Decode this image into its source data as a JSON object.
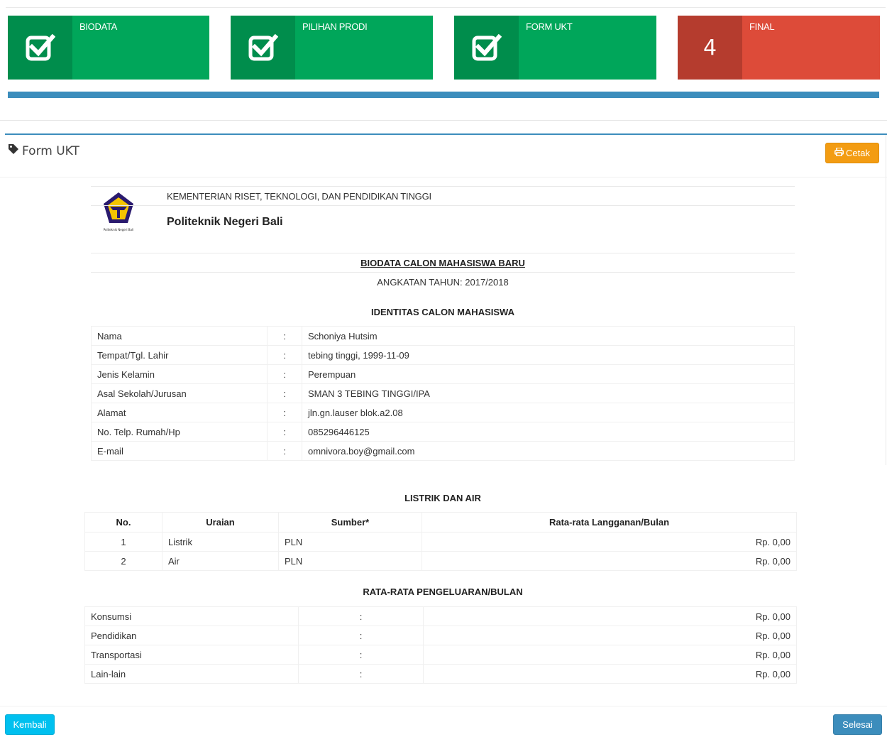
{
  "steps": [
    {
      "label": "BIODATA",
      "state": "done",
      "icon": "check-square-icon"
    },
    {
      "label": "PILIHAN PRODI",
      "state": "done",
      "icon": "check-square-icon"
    },
    {
      "label": "FORM UKT",
      "state": "done",
      "icon": "check-square-icon"
    },
    {
      "label": "FINAL",
      "state": "current",
      "number": "4"
    }
  ],
  "progress": {
    "percent": 100,
    "color": "#3c8dbc"
  },
  "colors": {
    "done_dark": "#008d4c",
    "done": "#00a65a",
    "current_dark": "#b53c2e",
    "current": "#dd4b39",
    "primary": "#3c8dbc",
    "warning": "#f39c12",
    "info": "#00c0ef"
  },
  "box": {
    "title": "Form UKT",
    "title_icon": "tag-icon",
    "print_label": "Cetak",
    "print_icon": "print-icon"
  },
  "header": {
    "ministry": "KEMENTERIAN RISET, TEKNOLOGI, DAN PENDIDIKAN TINGGI",
    "institution": "Politeknik Negeri Bali",
    "logo_caption": "Politeknik Negeri Bali"
  },
  "document": {
    "title": "BIODATA CALON MAHASISWA BARU",
    "subtitle": "ANGKATAN TAHUN: 2017/2018",
    "identity_heading": "IDENTITAS CALON MAHASISWA",
    "identity": [
      {
        "label": "Nama",
        "sep": ":",
        "value": "Schoniya Hutsim"
      },
      {
        "label": "Tempat/Tgl. Lahir",
        "sep": ":",
        "value": "tebing tinggi, 1999-11-09"
      },
      {
        "label": "Jenis Kelamin",
        "sep": ":",
        "value": "Perempuan"
      },
      {
        "label": "Asal Sekolah/Jurusan",
        "sep": ":",
        "value": "SMAN 3 TEBING TINGGI/IPA"
      },
      {
        "label": "Alamat",
        "sep": ":",
        "value": "jln.gn.lauser blok.a2.08"
      },
      {
        "label": "No. Telp. Rumah/Hp",
        "sep": ":",
        "value": "085296446125"
      },
      {
        "label": "E-mail",
        "sep": ":",
        "value": "omnivora.boy@gmail.com"
      }
    ],
    "utility_heading": "LISTRIK DAN AIR",
    "utility_columns": [
      "No.",
      "Uraian",
      "Sumber*",
      "Rata-rata Langganan/Bulan"
    ],
    "utility_rows": [
      {
        "no": "1",
        "uraian": "Listrik",
        "sumber": "PLN",
        "rata": "Rp. 0,00"
      },
      {
        "no": "2",
        "uraian": "Air",
        "sumber": "PLN",
        "rata": "Rp. 0,00"
      }
    ],
    "expense_heading": "RATA-RATA PENGELUARAN/BULAN",
    "expenses": [
      {
        "label": "Konsumsi",
        "sep": ":",
        "value": "Rp. 0,00"
      },
      {
        "label": "Pendidikan",
        "sep": ":",
        "value": "Rp. 0,00"
      },
      {
        "label": "Transportasi",
        "sep": ":",
        "value": "Rp. 0,00"
      },
      {
        "label": "Lain-lain",
        "sep": ":",
        "value": "Rp. 0,00"
      }
    ]
  },
  "footer": {
    "back_label": "Kembali",
    "finish_label": "Selesai"
  }
}
